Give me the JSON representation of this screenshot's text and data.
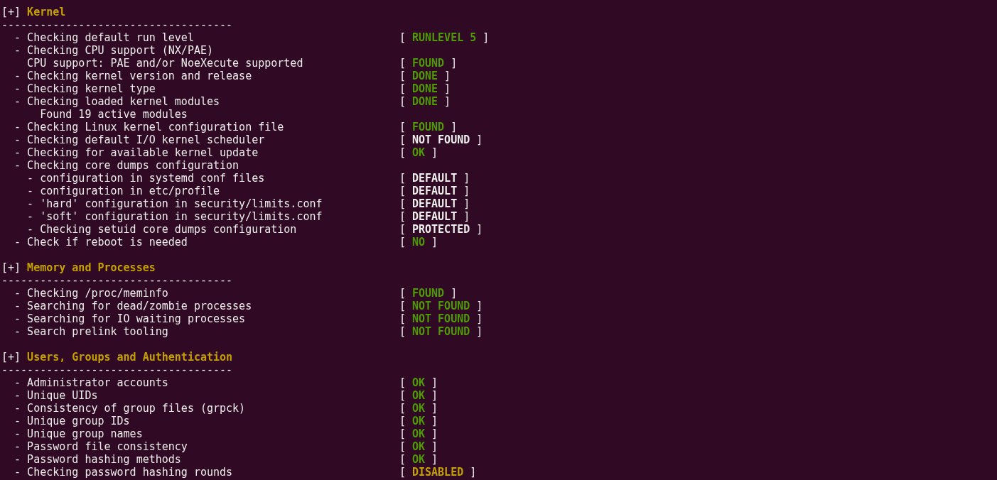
{
  "sections": [
    {
      "marker": "[+]",
      "title": "Kernel",
      "rule": "------------------------------------",
      "rows": [
        {
          "kind": "check",
          "text": "- Checking default run level",
          "status": {
            "open": "[",
            "text": "RUNLEVEL 5",
            "close": "]",
            "color": "#4e9a06"
          }
        },
        {
          "kind": "check",
          "text": "- Checking CPU support (NX/PAE)",
          "children": [
            {
              "kind": "info",
              "text": "CPU support: PAE and/or NoeXecute supported",
              "status": {
                "open": "[",
                "text": "FOUND",
                "close": "]",
                "color": "#4e9a06"
              }
            }
          ]
        },
        {
          "kind": "check",
          "text": "- Checking kernel version and release",
          "status": {
            "open": "[",
            "text": "DONE",
            "close": "]",
            "color": "#4e9a06"
          }
        },
        {
          "kind": "check",
          "text": "- Checking kernel type",
          "status": {
            "open": "[",
            "text": "DONE",
            "close": "]",
            "color": "#4e9a06"
          }
        },
        {
          "kind": "check",
          "text": "- Checking loaded kernel modules",
          "status": {
            "open": "[",
            "text": "DONE",
            "close": "]",
            "color": "#4e9a06"
          },
          "children": [
            {
              "kind": "note",
              "text": "Found 19 active modules"
            }
          ]
        },
        {
          "kind": "check",
          "text": "- Checking Linux kernel configuration file",
          "status": {
            "open": "[",
            "text": "FOUND",
            "close": "]",
            "color": "#4e9a06"
          }
        },
        {
          "kind": "check",
          "text": "- Checking default I/O kernel scheduler",
          "status": {
            "open": "[",
            "text": "NOT FOUND",
            "close": "]",
            "color": "#eeeeec"
          }
        },
        {
          "kind": "check",
          "text": "- Checking for available kernel update",
          "status": {
            "open": "[",
            "text": "OK",
            "close": "]",
            "color": "#4e9a06"
          }
        },
        {
          "kind": "check",
          "text": "- Checking core dumps configuration",
          "children": [
            {
              "kind": "check",
              "text": "- configuration in systemd conf files",
              "status": {
                "open": "[",
                "text": "DEFAULT",
                "close": "]",
                "color": "#eeeeec"
              }
            },
            {
              "kind": "check",
              "text": "- configuration in etc/profile",
              "status": {
                "open": "[",
                "text": "DEFAULT",
                "close": "]",
                "color": "#eeeeec"
              }
            },
            {
              "kind": "check",
              "text": "- 'hard' configuration in security/limits.conf",
              "status": {
                "open": "[",
                "text": "DEFAULT",
                "close": "]",
                "color": "#eeeeec"
              }
            },
            {
              "kind": "check",
              "text": "- 'soft' configuration in security/limits.conf",
              "status": {
                "open": "[",
                "text": "DEFAULT",
                "close": "]",
                "color": "#eeeeec"
              }
            },
            {
              "kind": "check",
              "text": "- Checking setuid core dumps configuration",
              "status": {
                "open": "[",
                "text": "PROTECTED",
                "close": "]",
                "color": "#eeeeec"
              }
            }
          ]
        },
        {
          "kind": "check",
          "text": "- Check if reboot is needed",
          "status": {
            "open": "[",
            "text": "NO",
            "close": "]",
            "color": "#4e9a06"
          }
        }
      ]
    },
    {
      "marker": "[+]",
      "title": "Memory and Processes",
      "rule": "------------------------------------",
      "rows": [
        {
          "kind": "check",
          "text": "- Checking /proc/meminfo",
          "status": {
            "open": "[",
            "text": "FOUND",
            "close": "]",
            "color": "#4e9a06"
          }
        },
        {
          "kind": "check",
          "text": "- Searching for dead/zombie processes",
          "status": {
            "open": "[",
            "text": "NOT FOUND",
            "close": "]",
            "color": "#4e9a06"
          }
        },
        {
          "kind": "check",
          "text": "- Searching for IO waiting processes",
          "status": {
            "open": "[",
            "text": "NOT FOUND",
            "close": "]",
            "color": "#4e9a06"
          }
        },
        {
          "kind": "check",
          "text": "- Search prelink tooling",
          "status": {
            "open": "[",
            "text": "NOT FOUND",
            "close": "]",
            "color": "#4e9a06"
          }
        }
      ]
    },
    {
      "marker": "[+]",
      "title": "Users, Groups and Authentication",
      "rule": "------------------------------------",
      "rows": [
        {
          "kind": "check",
          "text": "- Administrator accounts",
          "status": {
            "open": "[",
            "text": "OK",
            "close": "]",
            "color": "#4e9a06"
          }
        },
        {
          "kind": "check",
          "text": "- Unique UIDs",
          "status": {
            "open": "[",
            "text": "OK",
            "close": "]",
            "color": "#4e9a06"
          }
        },
        {
          "kind": "check",
          "text": "- Consistency of group files (grpck)",
          "status": {
            "open": "[",
            "text": "OK",
            "close": "]",
            "color": "#4e9a06"
          }
        },
        {
          "kind": "check",
          "text": "- Unique group IDs",
          "status": {
            "open": "[",
            "text": "OK",
            "close": "]",
            "color": "#4e9a06"
          }
        },
        {
          "kind": "check",
          "text": "- Unique group names",
          "status": {
            "open": "[",
            "text": "OK",
            "close": "]",
            "color": "#4e9a06"
          }
        },
        {
          "kind": "check",
          "text": "- Password file consistency",
          "status": {
            "open": "[",
            "text": "OK",
            "close": "]",
            "color": "#4e9a06"
          }
        },
        {
          "kind": "check",
          "text": "- Password hashing methods",
          "status": {
            "open": "[",
            "text": "OK",
            "close": "]",
            "color": "#4e9a06"
          }
        },
        {
          "kind": "check",
          "text": "- Checking password hashing rounds",
          "status": {
            "open": "[",
            "text": "DISABLED",
            "close": "]",
            "color": "#c4a000"
          }
        }
      ]
    }
  ]
}
